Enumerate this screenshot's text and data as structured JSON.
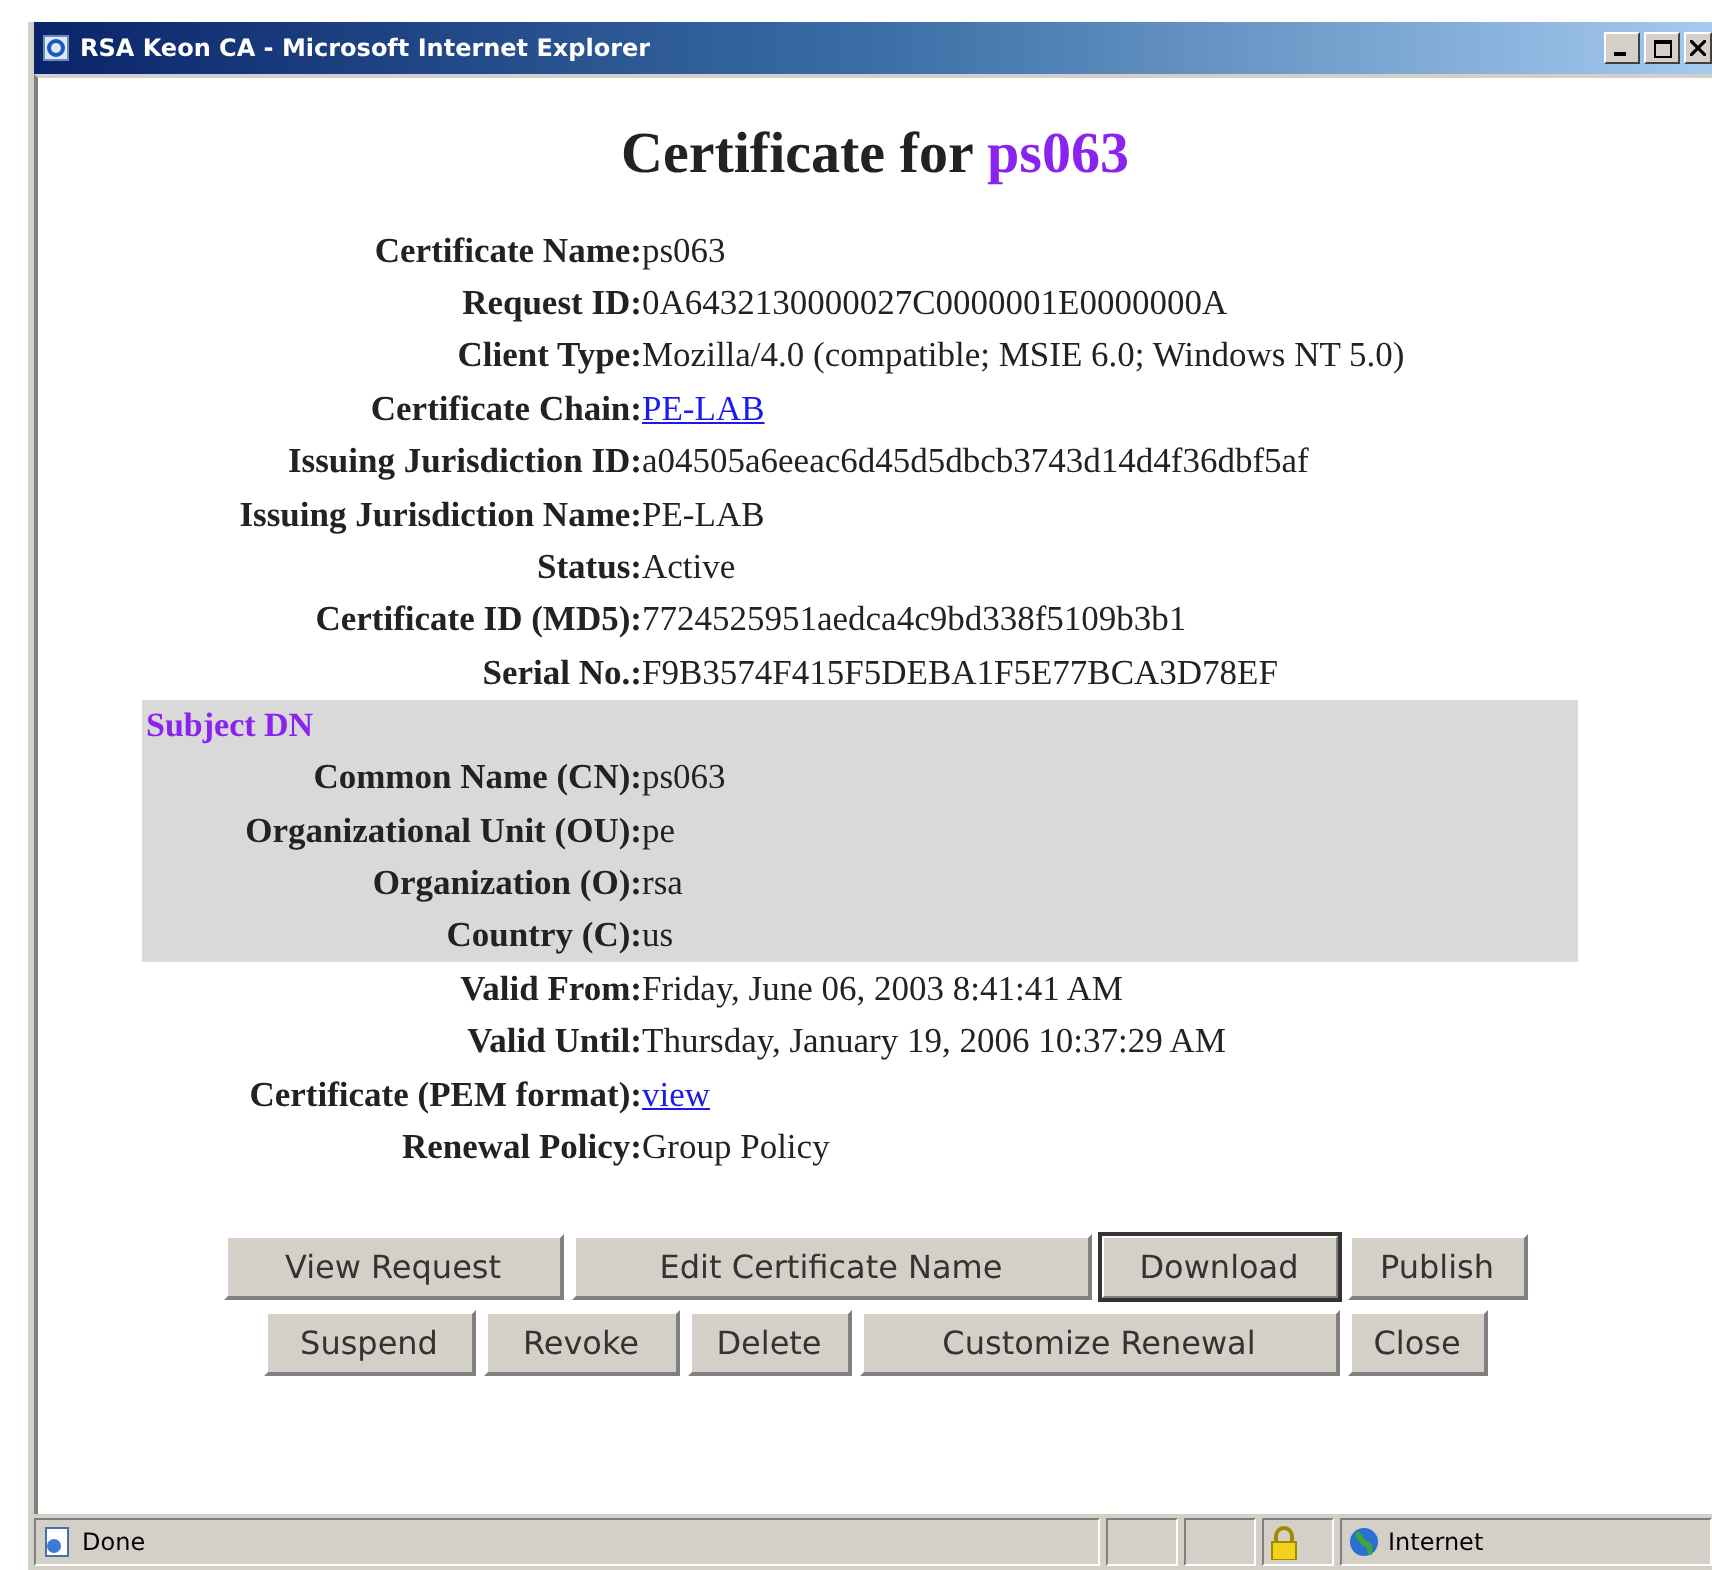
{
  "window": {
    "title": "RSA Keon CA - Microsoft Internet Explorer"
  },
  "heading": {
    "text": "Certificate for ",
    "name": "ps063"
  },
  "fields": [
    {
      "label": "Certificate Name:",
      "value": "ps063",
      "kind": "text"
    },
    {
      "label": "Request ID:",
      "value": "0A6432130000027C0000001E0000000A",
      "kind": "text"
    },
    {
      "label": "Client Type:",
      "value": "Mozilla/4.0 (compatible; MSIE 6.0; Windows NT 5.0)",
      "kind": "text"
    },
    {
      "label": "Certificate Chain:",
      "value": "PE-LAB",
      "kind": "link"
    },
    {
      "label": "Issuing Jurisdiction ID:",
      "value": "a04505a6eeac6d45d5dbcb3743d14d4f36dbf5af",
      "kind": "text"
    },
    {
      "label": "Issuing Jurisdiction Name:",
      "value": "PE-LAB",
      "kind": "text"
    },
    {
      "label": "Status:",
      "value": "Active",
      "kind": "text"
    },
    {
      "label": "Certificate ID (MD5):",
      "value": "7724525951aedca4c9bd338f5109b3b1",
      "kind": "text"
    },
    {
      "label": "Serial No.:",
      "value": "F9B3574F415F5DEBA1F5E77BCA3D78EF",
      "kind": "text"
    }
  ],
  "subject_dn": {
    "title": "Subject DN",
    "fields": [
      {
        "label": "Common Name (CN):",
        "value": "ps063"
      },
      {
        "label": "Organizational Unit (OU):",
        "value": "pe"
      },
      {
        "label": "Organization (O):",
        "value": "rsa"
      },
      {
        "label": "Country (C):",
        "value": "us"
      }
    ]
  },
  "fields_after": [
    {
      "label": "Valid From:",
      "value": "Friday, June 06, 2003 8:41:41 AM",
      "kind": "text"
    },
    {
      "label": "Valid Until:",
      "value": "Thursday, January 19, 2006 10:37:29 AM",
      "kind": "text"
    },
    {
      "label": "Certificate (PEM format):",
      "value": "view",
      "kind": "link"
    },
    {
      "label": "Renewal Policy:",
      "value": "Group Policy",
      "kind": "text"
    }
  ],
  "button_rows": [
    [
      {
        "label": "View Request",
        "focused": false
      },
      {
        "label": "Edit Certificate Name",
        "focused": false
      },
      {
        "label": "Download",
        "focused": true
      },
      {
        "label": "Publish",
        "focused": false
      }
    ],
    [
      {
        "label": "Suspend",
        "focused": false
      },
      {
        "label": "Revoke",
        "focused": false
      },
      {
        "label": "Delete",
        "focused": false
      },
      {
        "label": "Customize Renewal",
        "focused": false
      },
      {
        "label": "Close",
        "focused": false
      }
    ]
  ],
  "status_bar": {
    "text": "Done",
    "zone": "Internet"
  }
}
